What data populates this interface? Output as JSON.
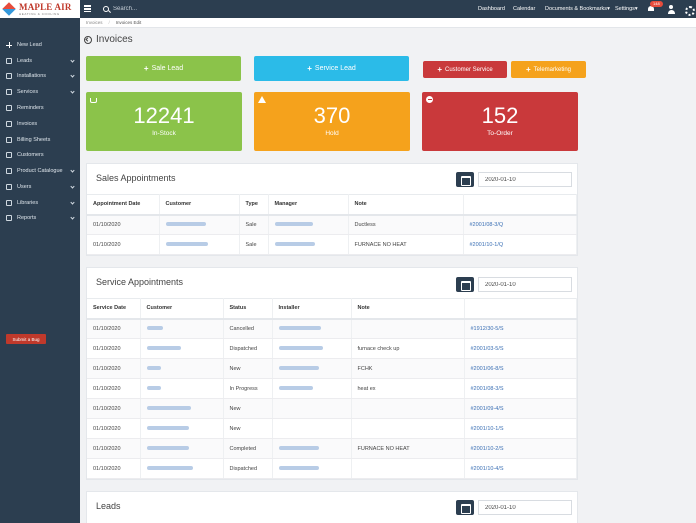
{
  "brand": {
    "name": "MAPLE AIR",
    "tagline": "HEATING & COOLING"
  },
  "search": {
    "placeholder": "Search..."
  },
  "topnav": {
    "dashboard": "Dashboard",
    "calendar": "Calendar",
    "documents": "Documents & Bookmarks",
    "settings": "Settings",
    "notification_count": "148"
  },
  "sidebar": {
    "items": [
      {
        "label": "New Lead",
        "icon": "plus-icon",
        "chevron": false
      },
      {
        "label": "Leads",
        "icon": "leads-icon",
        "chevron": true
      },
      {
        "label": "Installations",
        "icon": "install-icon",
        "chevron": true
      },
      {
        "label": "Services",
        "icon": "services-icon",
        "chevron": true
      },
      {
        "label": "Reminders",
        "icon": "bell-icon",
        "chevron": false
      },
      {
        "label": "Invoices",
        "icon": "dollar-icon",
        "chevron": false
      },
      {
        "label": "Billing Sheets",
        "icon": "sheet-icon",
        "chevron": false
      },
      {
        "label": "Customers",
        "icon": "users-icon",
        "chevron": false
      },
      {
        "label": "Product Catalogue",
        "icon": "catalogue-icon",
        "chevron": true
      },
      {
        "label": "Users",
        "icon": "user-icon",
        "chevron": true
      },
      {
        "label": "Libraries",
        "icon": "library-icon",
        "chevron": true
      },
      {
        "label": "Reports",
        "icon": "reports-icon",
        "chevron": true
      }
    ],
    "submit_bug": "Submit a Bug"
  },
  "breadcrumb": {
    "parent": "Invoices",
    "current": "Invoices Edit"
  },
  "page_title": "Invoices",
  "actions": {
    "sale_lead": "Sale Lead",
    "service_lead": "Service Lead",
    "customer_service": "Customer Service",
    "telemarketing": "Telemarketing"
  },
  "stats": [
    {
      "value": "12241",
      "label": "In-Stock",
      "color": "#8bc34a"
    },
    {
      "value": "370",
      "label": "Hold",
      "color": "#f5a21c"
    },
    {
      "value": "152",
      "label": "To-Order",
      "color": "#c9393b"
    }
  ],
  "sales": {
    "title": "Sales Appointments",
    "date": "2020-01-10",
    "headers": [
      "Appointment Date",
      "Customer",
      "Type",
      "Manager",
      "Note",
      ""
    ],
    "rows": [
      {
        "date": "01/10/2020",
        "type": "Sale",
        "note": "Ductless",
        "ref": "#2001/08-3/Q"
      },
      {
        "date": "01/10/2020",
        "type": "Sale",
        "note": "FURNACE NO HEAT",
        "ref": "#2001/10-1/Q"
      }
    ]
  },
  "service": {
    "title": "Service Appointments",
    "date": "2020-01-10",
    "headers": [
      "Service Date",
      "Customer",
      "Status",
      "Installer",
      "Note",
      ""
    ],
    "rows": [
      {
        "date": "01/10/2020",
        "status": "Cancelled",
        "note": "",
        "ref": "#1912/30-5/S"
      },
      {
        "date": "01/10/2020",
        "status": "Dispatched",
        "note": "furnace check up",
        "ref": "#2001/03-5/S"
      },
      {
        "date": "01/10/2020",
        "status": "New",
        "note": "FCHK",
        "ref": "#2001/06-8/S"
      },
      {
        "date": "01/10/2020",
        "status": "In Progress",
        "note": "heat ex",
        "ref": "#2001/08-3/S"
      },
      {
        "date": "01/10/2020",
        "status": "New",
        "note": "",
        "ref": "#2001/09-4/S"
      },
      {
        "date": "01/10/2020",
        "status": "New",
        "note": "",
        "ref": "#2001/10-1/S"
      },
      {
        "date": "01/10/2020",
        "status": "Completed",
        "note": "FURNACE NO HEAT",
        "ref": "#2001/10-2/S"
      },
      {
        "date": "01/10/2020",
        "status": "Dispatched",
        "note": "",
        "ref": "#2001/10-4/S"
      }
    ]
  },
  "leads": {
    "title": "Leads",
    "date": "2020-01-10"
  }
}
